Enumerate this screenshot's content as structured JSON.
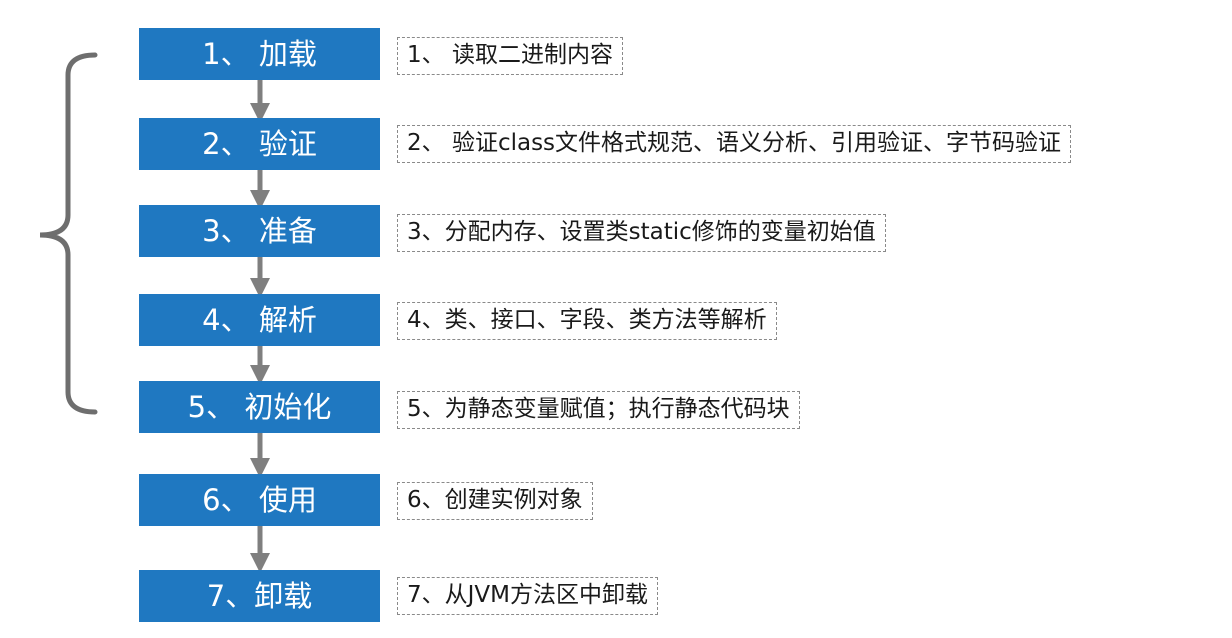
{
  "steps": [
    {
      "label": "1、 加载",
      "description": "1、 读取二进制内容"
    },
    {
      "label": "2、 验证",
      "description": "2、 验证class文件格式规范、语义分析、引用验证、字节码验证"
    },
    {
      "label": "3、 准备",
      "description": "3、分配内存、设置类static修饰的变量初始值"
    },
    {
      "label": "4、 解析",
      "description": "4、类、接口、字段、类方法等解析"
    },
    {
      "label": "5、 初始化",
      "description": "5、为静态变量赋值；执行静态代码块"
    },
    {
      "label": "6、 使用",
      "description": "6、创建实例对象"
    },
    {
      "label": "7、卸载",
      "description": "7、从JVM方法区中卸载"
    }
  ],
  "colors": {
    "step_fill": "#1f78c1",
    "step_text": "#ffffff",
    "arrow": "#7f7f7f",
    "brace": "#6e6e6e",
    "desc_border": "#8a8a8a"
  }
}
